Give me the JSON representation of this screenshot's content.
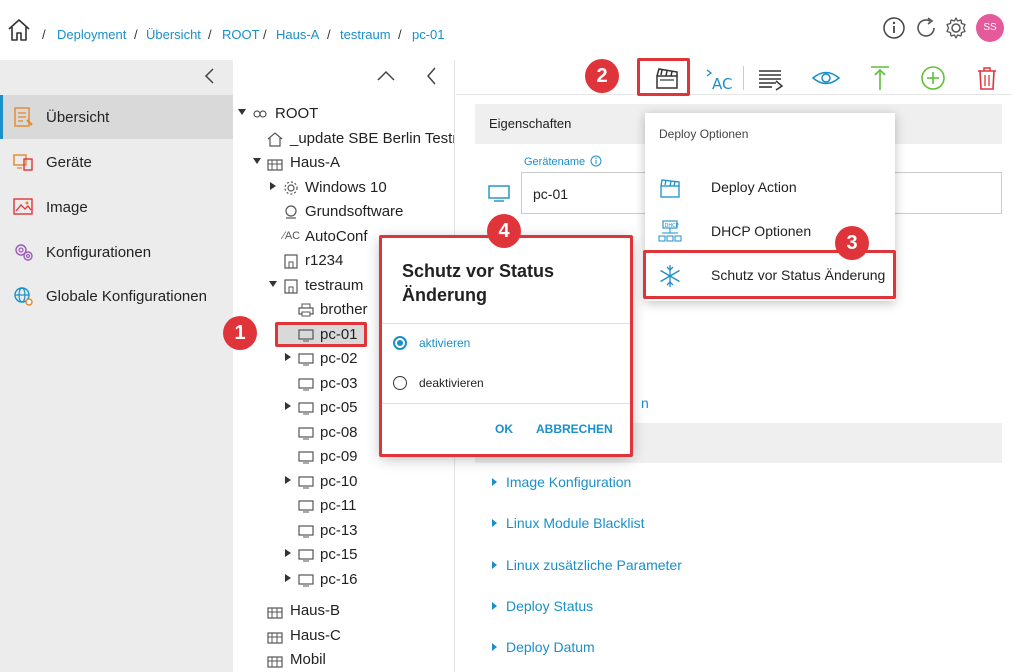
{
  "breadcrumb": {
    "items": [
      "Deployment",
      "Übersicht",
      "ROOT",
      "Haus-A",
      "testraum",
      "pc-01"
    ],
    "separator": "/"
  },
  "header": {
    "avatar_initials": "SS",
    "icons": [
      "home-icon",
      "info-icon",
      "refresh-icon",
      "settings-icon"
    ]
  },
  "sidebar": {
    "items": [
      {
        "label": "Übersicht",
        "icon": "overview-icon",
        "active": true
      },
      {
        "label": "Geräte",
        "icon": "devices-icon"
      },
      {
        "label": "Image",
        "icon": "image-icon"
      },
      {
        "label": "Konfigurationen",
        "icon": "configurations-icon"
      },
      {
        "label": "Globale Konfigurationen",
        "icon": "global-config-icon"
      }
    ]
  },
  "tree": {
    "nodes": [
      {
        "label": "ROOT"
      },
      {
        "label": "_update SBE Berlin Testra"
      },
      {
        "label": "Haus-A"
      },
      {
        "label": "Windows 10"
      },
      {
        "label": "Grundsoftware"
      },
      {
        "label": "AutoConf"
      },
      {
        "label": "r1234"
      },
      {
        "label": "testraum"
      },
      {
        "label": "brother"
      },
      {
        "label": "pc-01"
      },
      {
        "label": "pc-02"
      },
      {
        "label": "pc-03"
      },
      {
        "label": "pc-05"
      },
      {
        "label": "pc-08"
      },
      {
        "label": "pc-09"
      },
      {
        "label": "pc-10"
      },
      {
        "label": "pc-11"
      },
      {
        "label": "pc-13"
      },
      {
        "label": "pc-15"
      },
      {
        "label": "pc-16"
      },
      {
        "label": "Haus-B"
      },
      {
        "label": "Haus-C"
      },
      {
        "label": "Mobil"
      }
    ]
  },
  "content": {
    "properties_header": "Eigenschaften",
    "device_name_label": "Gerätename",
    "device_name_value": "pc-01",
    "partial_link": "n",
    "links": [
      "Image Konfiguration",
      "Linux Module Blacklist",
      "Linux zusätzliche Parameter",
      "Deploy Status",
      "Deploy Datum"
    ]
  },
  "deploy_menu": {
    "title": "Deploy Optionen",
    "items": [
      {
        "label": "Deploy Action",
        "icon": "clapperboard-icon"
      },
      {
        "label": "DHCP Optionen",
        "icon": "dhcp-network-icon"
      },
      {
        "label": "Schutz vor Status Änderung",
        "icon": "snowflake-icon"
      }
    ]
  },
  "dialog": {
    "title": "Schutz vor Status Änderung",
    "options": [
      {
        "label": "aktivieren",
        "selected": true
      },
      {
        "label": "deaktivieren",
        "selected": false
      }
    ],
    "ok_label": "OK",
    "cancel_label": "ABBRECHEN"
  },
  "annotations": {
    "badges": [
      "1",
      "2",
      "3",
      "4"
    ],
    "color": "#e0343b"
  },
  "colors": {
    "accent": "#1a8fc9",
    "avatar": "#e55a9a",
    "add": "#5fbf3a",
    "delete": "#e0343b"
  }
}
